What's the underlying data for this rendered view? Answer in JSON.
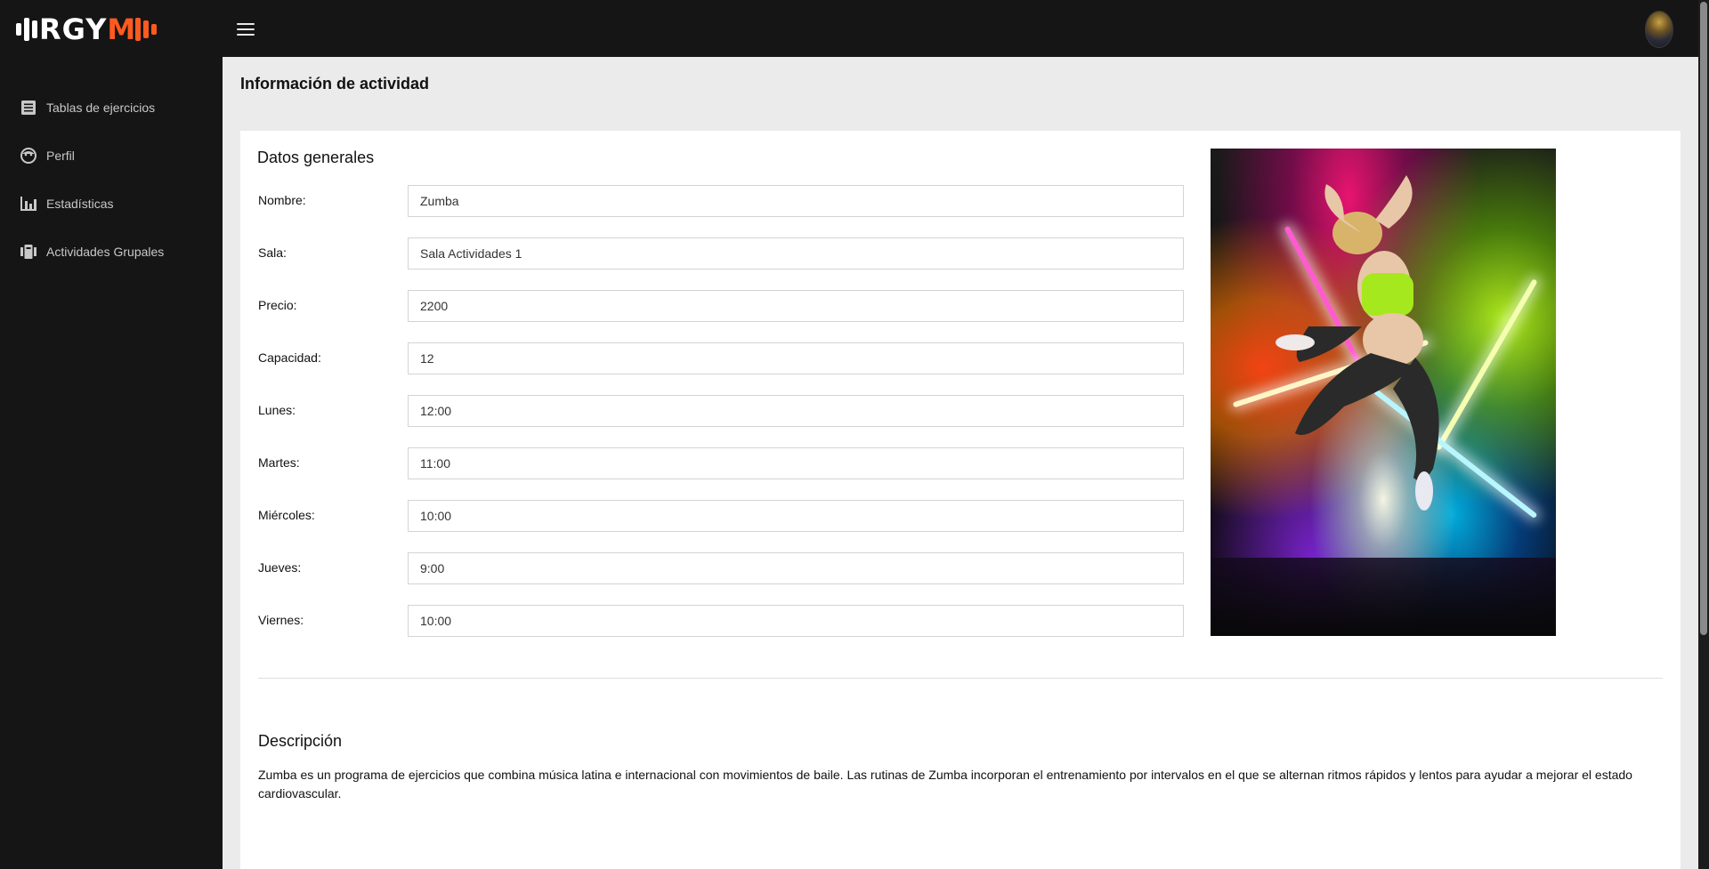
{
  "header": {
    "logo_text_white": "RGY",
    "logo_text_accent": "M",
    "menu_icon": "hamburger-menu-icon",
    "avatar_icon": "user-avatar"
  },
  "colors": {
    "accent": "#ff5a1f",
    "sidebar_bg": "#151515",
    "main_bg": "#ebebeb"
  },
  "sidebar": {
    "items": [
      {
        "label": "Tablas de ejercicios",
        "icon": "list-document-icon"
      },
      {
        "label": "Perfil",
        "icon": "face-profile-icon"
      },
      {
        "label": "Estadísticas",
        "icon": "bar-chart-icon"
      },
      {
        "label": "Actividades Grupales",
        "icon": "group-activity-icon"
      }
    ]
  },
  "page": {
    "title": "Información de actividad"
  },
  "general": {
    "section_title": "Datos generales",
    "fields": [
      {
        "label": "Nombre:",
        "value": "Zumba"
      },
      {
        "label": "Sala:",
        "value": "Sala Actividades 1"
      },
      {
        "label": "Precio:",
        "value": "2200"
      },
      {
        "label": "Capacidad:",
        "value": "12"
      },
      {
        "label": "Lunes:",
        "value": "12:00"
      },
      {
        "label": "Martes:",
        "value": "11:00"
      },
      {
        "label": "Miércoles:",
        "value": "10:00"
      },
      {
        "label": "Jueves:",
        "value": "9:00"
      },
      {
        "label": "Viernes:",
        "value": "10:00"
      }
    ]
  },
  "description": {
    "section_title": "Descripción",
    "text": "Zumba es un programa de ejercicios que combina música latina e internacional con movimientos de baile. Las rutinas de Zumba incorporan el entrenamiento por intervalos en el que se alternan ritmos rápidos y lentos para ayudar a mejorar el estado cardiovascular."
  }
}
